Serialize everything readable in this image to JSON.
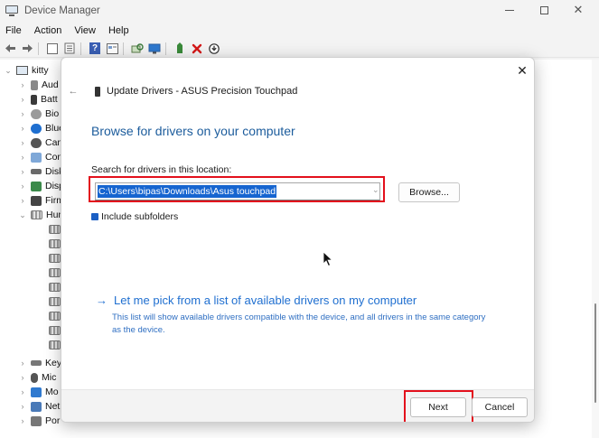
{
  "window": {
    "title": "Device Manager",
    "minimize_icon": "minimize-icon",
    "maximize_icon": "maximize-icon",
    "close_glyph": "✕"
  },
  "menu": {
    "items": [
      "File",
      "Action",
      "View",
      "Help"
    ]
  },
  "toolbar": {
    "icons": [
      "back-arrow-icon",
      "forward-arrow-icon",
      "properties-icon",
      "update-icon",
      "help-icon",
      "view-icon",
      "scan-icon",
      "monitor-icon",
      "add-driver-icon",
      "uninstall-icon",
      "disable-icon"
    ]
  },
  "tree": {
    "root": "kitty",
    "items": [
      {
        "label": "Aud",
        "expanded": false
      },
      {
        "label": "Batt",
        "expanded": false
      },
      {
        "label": "Bio",
        "expanded": false
      },
      {
        "label": "Blue",
        "expanded": false
      },
      {
        "label": "Cam",
        "expanded": false
      },
      {
        "label": "Con",
        "expanded": false
      },
      {
        "label": "Disk",
        "expanded": false
      },
      {
        "label": "Disp",
        "expanded": false
      },
      {
        "label": "Firm",
        "expanded": false
      },
      {
        "label": "Hum",
        "expanded": true
      },
      {
        "label": "Key",
        "expanded": false
      },
      {
        "label": "Mic",
        "expanded": false
      },
      {
        "label": "Mo",
        "expanded": false
      },
      {
        "label": "Net",
        "expanded": false
      },
      {
        "label": "Por",
        "expanded": false
      }
    ],
    "hid_children": 9
  },
  "dialog": {
    "close_glyph": "✕",
    "back_glyph": "←",
    "header": "Update Drivers - ASUS Precision Touchpad",
    "heading": "Browse for drivers on your computer",
    "search_label": "Search for drivers in this location:",
    "path_value": "C:\\Users\\bipas\\Downloads\\Asus touchpad",
    "path_caret": "⌄",
    "browse_label": "Browse...",
    "include_subfolders_label": "Include subfolders",
    "include_subfolders_checked": true,
    "pick_arrow": "→",
    "pick_link": "Let me pick from a list of available drivers on my computer",
    "pick_desc": "This list will show available drivers compatible with the device, and all drivers in the same category as the device.",
    "next_label": "Next",
    "cancel_label": "Cancel"
  },
  "colors": {
    "accent": "#1c5c9c",
    "link": "#1f6fd0",
    "highlight": "#e3101c",
    "selection": "#1665d0"
  }
}
